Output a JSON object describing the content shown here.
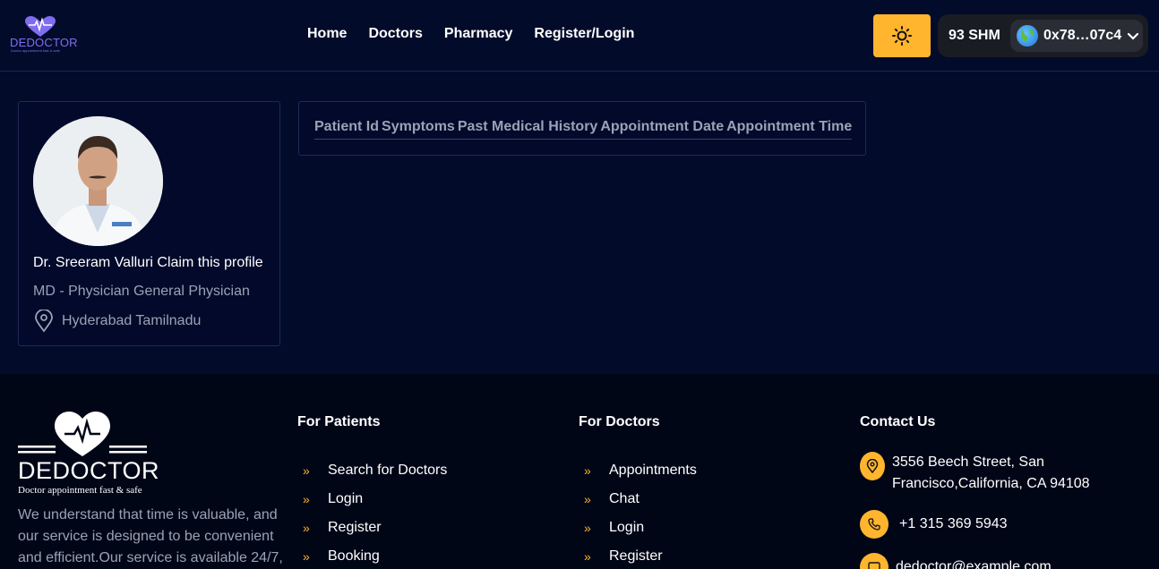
{
  "header": {
    "logo_text": "DEDOCTOR",
    "logo_tagline": "Doctor appointment fast & safe",
    "nav": [
      "Home",
      "Doctors",
      "Pharmacy",
      "Register/Login"
    ],
    "theme_icon": "sun-icon",
    "wallet": {
      "balance": "93 SHM",
      "address": "0x78…07c4"
    }
  },
  "profile": {
    "name": "Dr. Sreeram Valluri Claim this profile",
    "specialty": "MD - Physician General Physician",
    "location": "Hyderabad Tamilnadu"
  },
  "table": {
    "columns": [
      "Patient Id",
      "Symptoms",
      "Past Medical History",
      "Appointment Date",
      "Appointment Time"
    ]
  },
  "footer": {
    "logo_text": "DEDOCTOR",
    "logo_tagline": "Doctor appointment fast & safe",
    "about": "We understand that time is valuable, and our service is designed to be convenient and efficient.Our service is available 24/7,",
    "for_patients": {
      "title": "For Patients",
      "links": [
        "Search for Doctors",
        "Login",
        "Register",
        "Booking"
      ]
    },
    "for_doctors": {
      "title": "For Doctors",
      "links": [
        "Appointments",
        "Chat",
        "Login",
        "Register"
      ]
    },
    "contact": {
      "title": "Contact Us",
      "address_line1": "3556 Beech Street, San",
      "address_line2": "Francisco,California, CA 94108",
      "phone": "+1 315 369 5943",
      "email": "dedoctor@example.com"
    }
  },
  "colors": {
    "accent": "#ffb52e",
    "background": "#020b2a",
    "footer_bg": "#010617",
    "brand_purple": "#7f6cf0"
  }
}
